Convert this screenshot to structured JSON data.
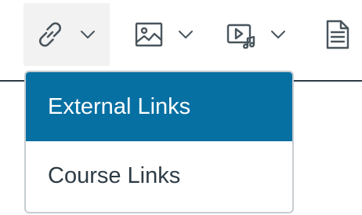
{
  "toolbar": {
    "buttons": [
      {
        "name": "links",
        "icon": "link-icon",
        "active": true
      },
      {
        "name": "images",
        "icon": "image-icon"
      },
      {
        "name": "media",
        "icon": "media-icon"
      },
      {
        "name": "documents",
        "icon": "document-icon"
      }
    ]
  },
  "menu": {
    "items": [
      {
        "label": "External Links",
        "selected": true
      },
      {
        "label": "Course Links",
        "selected": false
      }
    ]
  },
  "colors": {
    "accent": "#0770a3",
    "text": "#2d3b45",
    "icon": "#49545c",
    "border": "#c7cdd1",
    "active_button_bg": "#f2f2f2"
  }
}
